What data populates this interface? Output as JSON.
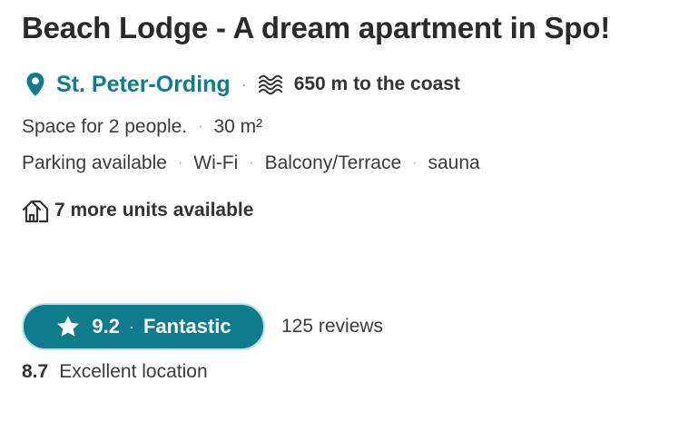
{
  "listing": {
    "title": "Beach Lodge - A dream apartment in Spo!",
    "location": "St. Peter-Ording",
    "separator": "·",
    "coast_distance": "650 m to the coast"
  },
  "details": {
    "capacity": "Space for 2 people.",
    "area": "30 m²",
    "amenities": [
      "Parking available",
      "Wi-Fi",
      "Balcony/Terrace",
      "sauna"
    ]
  },
  "units": {
    "label": "7 more units available"
  },
  "rating": {
    "score": "9.2",
    "verdict": "Fantastic",
    "reviews": "125 reviews",
    "location_score": "8.7",
    "location_label": "Excellent location"
  },
  "icons": {
    "location": "map-pin-icon",
    "coast": "waves-icon",
    "units": "house-icon",
    "rating": "star-icon"
  },
  "colors": {
    "accent": "#0f7c8e",
    "text": "#2a2a2a"
  }
}
